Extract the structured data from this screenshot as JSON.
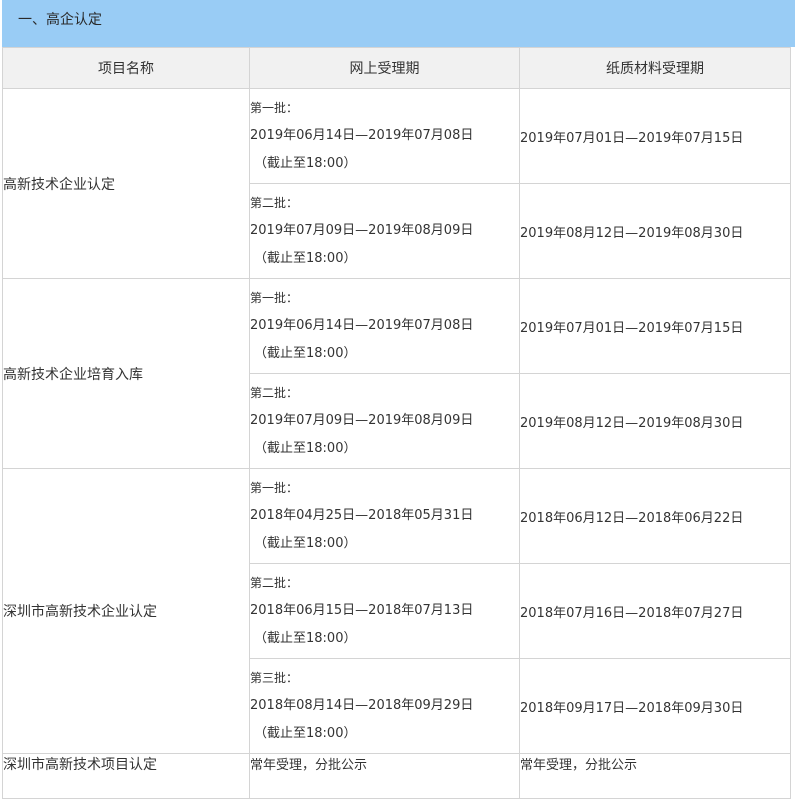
{
  "section": {
    "title": "一、高企认定"
  },
  "table": {
    "headers": [
      "项目名称",
      "网上受理期",
      "纸质材料受理期"
    ],
    "groups": [
      {
        "name": "高新技术企业认定",
        "batches": [
          {
            "label": "第一批：",
            "online": "2019年06月14日—2019年07月08日",
            "deadline": "（截止至18:00）",
            "paper": "2019年07月01日—2019年07月15日"
          },
          {
            "label": "第二批：",
            "online": "2019年07月09日—2019年08月09日",
            "deadline": "（截止至18:00）",
            "paper": "2019年08月12日—2019年08月30日"
          }
        ]
      },
      {
        "name": "高新技术企业培育入库",
        "batches": [
          {
            "label": "第一批：",
            "online": "2019年06月14日—2019年07月08日",
            "deadline": "（截止至18:00）",
            "paper": "2019年07月01日—2019年07月15日"
          },
          {
            "label": "第二批：",
            "online": "2019年07月09日—2019年08月09日",
            "deadline": "（截止至18:00）",
            "paper": "2019年08月12日—2019年08月30日"
          }
        ]
      },
      {
        "name": "深圳市高新技术企业认定",
        "batches": [
          {
            "label": "第一批：",
            "online": "2018年04月25日—2018年05月31日",
            "deadline": "（截止至18:00）",
            "paper": "2018年06月12日—2018年06月22日"
          },
          {
            "label": "第二批：",
            "online": "2018年06月15日—2018年07月13日",
            "deadline": "（截止至18:00）",
            "paper": "2018年07月16日—2018年07月27日"
          },
          {
            "label": "第三批：",
            "online": "2018年08月14日—2018年09月29日",
            "deadline": "（截止至18:00）",
            "paper": "2018年09月17日—2018年09月30日"
          }
        ]
      },
      {
        "name": "深圳市高新技术项目认定",
        "online_text": "常年受理，分批公示",
        "paper_text": "常年受理，分批公示"
      }
    ]
  }
}
